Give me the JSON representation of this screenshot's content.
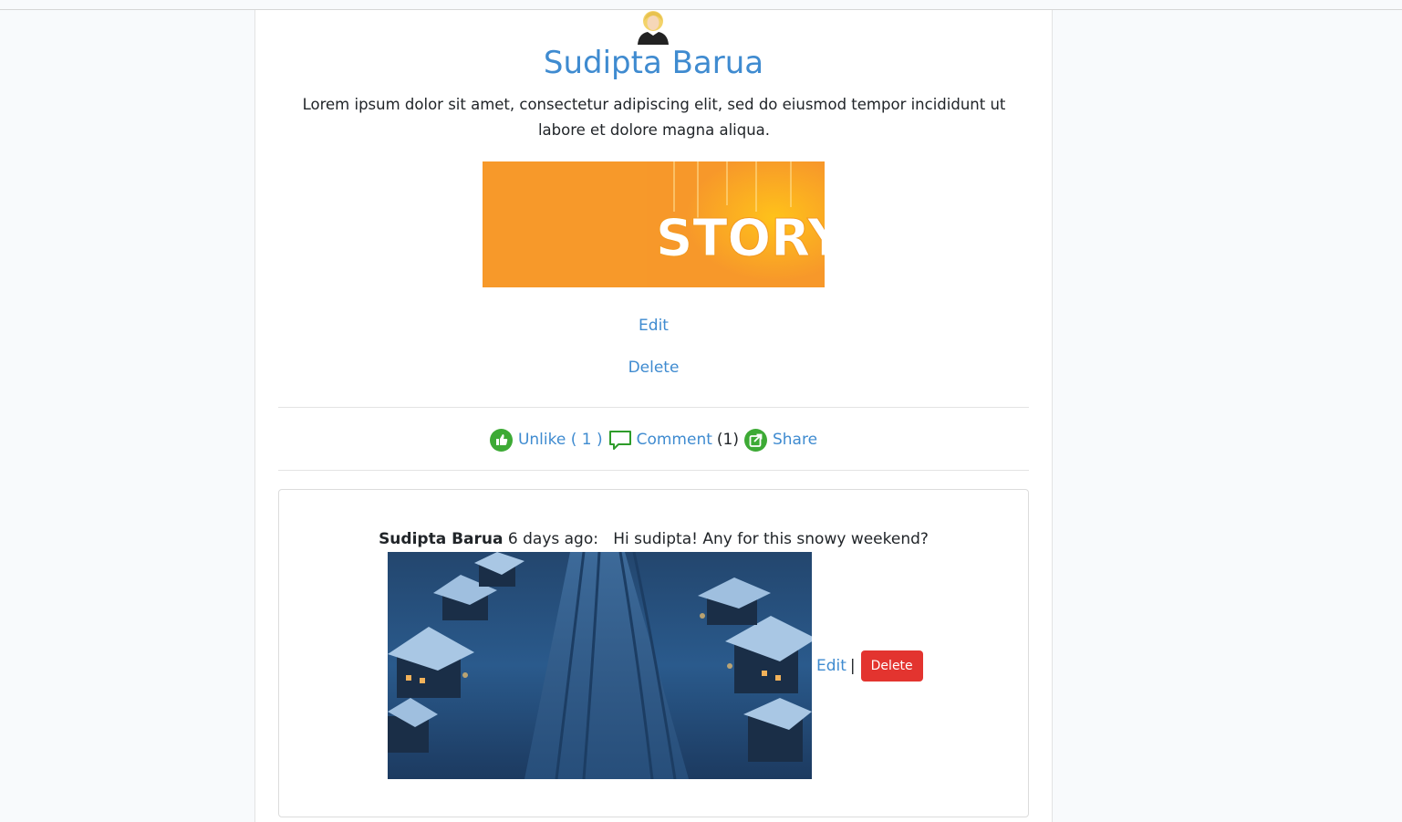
{
  "post": {
    "author": "Sudipta Barua",
    "body": "Lorem ipsum dolor sit amet, consectetur adipiscing elit, sed do eiusmod tempor incididunt ut labore et dolore magna aliqua.",
    "image_text": "STORY",
    "edit_label": "Edit",
    "delete_label": "Delete"
  },
  "actions": {
    "like_label": "Unlike ( 1 )",
    "comment_label": "Comment",
    "comment_count": "(1)",
    "share_label": "Share"
  },
  "comment": {
    "author": "Sudipta Barua",
    "time": "6 days ago:",
    "text": "Hi sudipta! Any for this snowy weekend?",
    "edit_label": "Edit",
    "separator": "|",
    "delete_label": "Delete"
  },
  "colors": {
    "link": "#3f8bd0",
    "danger": "#e3342f",
    "icon_green": "#3daa35",
    "story_orange": "#f7a12a"
  },
  "icons": {
    "avatar": "user-avatar-icon",
    "like": "thumbs-up-icon",
    "comment": "speech-bubble-icon",
    "share": "share-icon"
  }
}
